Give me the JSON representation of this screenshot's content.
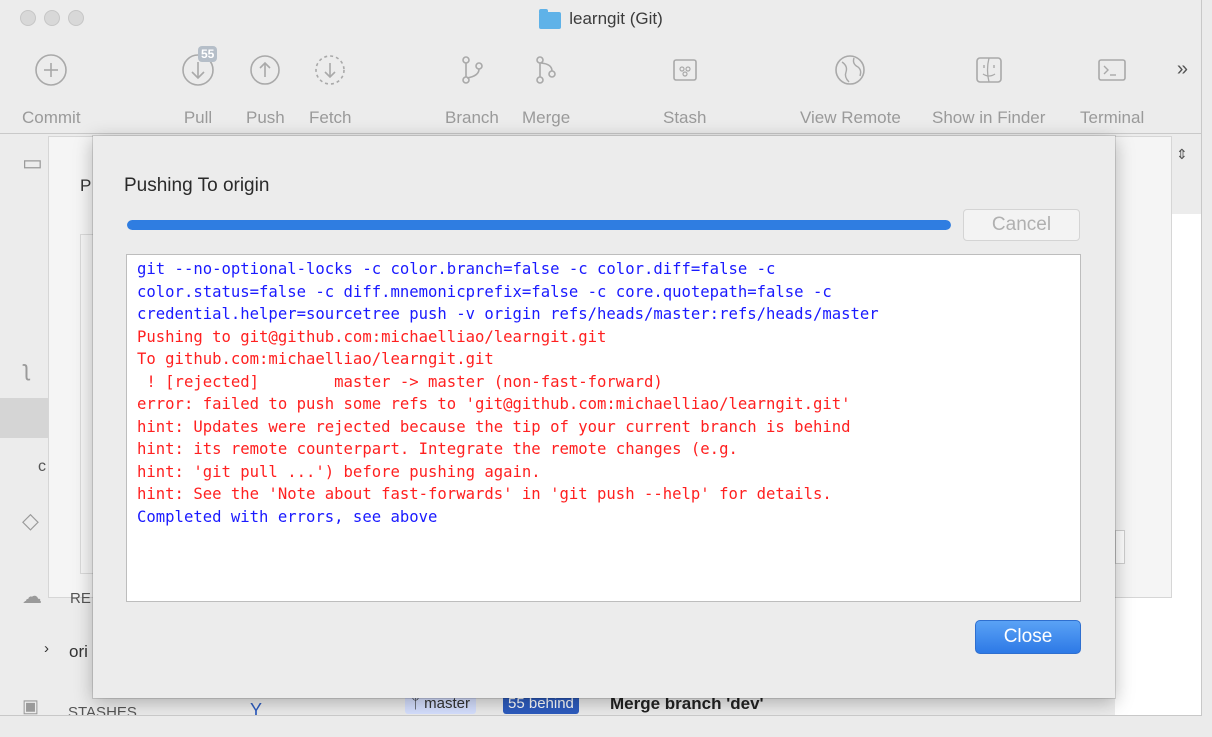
{
  "window": {
    "title": "learngit (Git)"
  },
  "toolbar": {
    "items": [
      {
        "label": "Commit",
        "icon": "plus-circle-icon"
      },
      {
        "label": "Pull",
        "icon": "pull-down-arrow-icon",
        "badge": "55"
      },
      {
        "label": "Push",
        "icon": "push-up-arrow-icon"
      },
      {
        "label": "Fetch",
        "icon": "fetch-down-arrow-icon"
      },
      {
        "label": "Branch",
        "icon": "branch-icon"
      },
      {
        "label": "Merge",
        "icon": "merge-icon"
      },
      {
        "label": "Stash",
        "icon": "stash-icon"
      },
      {
        "label": "View Remote",
        "icon": "globe-icon"
      },
      {
        "label": "Show in Finder",
        "icon": "finder-icon"
      },
      {
        "label": "Terminal",
        "icon": "terminal-icon"
      }
    ],
    "overflow": "»"
  },
  "background": {
    "sidebar_p": "P",
    "remotes_label": "RE",
    "origin_label": "ori",
    "stashes_label": "STASHES",
    "commit_branch": "master",
    "commit_behind": "55 behind",
    "commit_message": "Merge branch 'dev'"
  },
  "dialog": {
    "title": "Pushing To origin",
    "progress": 1.0,
    "cancel_label": "Cancel",
    "close_label": "Close",
    "log": [
      {
        "text": "git --no-optional-locks -c color.branch=false -c color.diff=false -c",
        "color": "#1a1aff"
      },
      {
        "text": "color.status=false -c diff.mnemonicprefix=false -c core.quotepath=false -c",
        "color": "#1a1aff"
      },
      {
        "text": "credential.helper=sourcetree push -v origin refs/heads/master:refs/heads/master",
        "color": "#1a1aff"
      },
      {
        "text": "Pushing to git@github.com:michaelliao/learngit.git",
        "color": "#ff2020"
      },
      {
        "text": "To github.com:michaelliao/learngit.git",
        "color": "#ff2020"
      },
      {
        "text": " ! [rejected]        master -> master (non-fast-forward)",
        "color": "#ff2020"
      },
      {
        "text": "error: failed to push some refs to 'git@github.com:michaelliao/learngit.git'",
        "color": "#ff2020"
      },
      {
        "text": "hint: Updates were rejected because the tip of your current branch is behind",
        "color": "#ff2020"
      },
      {
        "text": "hint: its remote counterpart. Integrate the remote changes (e.g.",
        "color": "#ff2020"
      },
      {
        "text": "hint: 'git pull ...') before pushing again.",
        "color": "#ff2020"
      },
      {
        "text": "hint: See the 'Note about fast-forwards' in 'git push --help' for details.",
        "color": "#ff2020"
      },
      {
        "text": "Completed with errors, see above",
        "color": "#1a1aff"
      }
    ]
  }
}
